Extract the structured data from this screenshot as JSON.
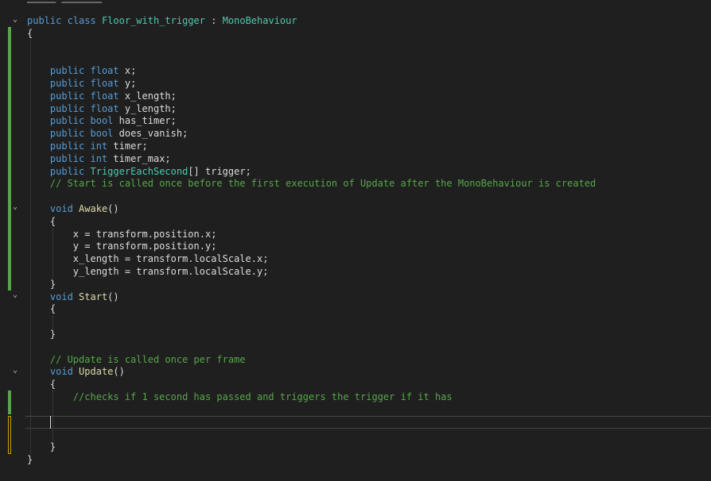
{
  "editor": {
    "language": "C#",
    "lines": [
      {
        "tokens": [
          {
            "t": "public",
            "c": "kw"
          },
          {
            "t": " "
          },
          {
            "t": "class",
            "c": "kw"
          },
          {
            "t": " "
          },
          {
            "t": "Floor_with_trigger",
            "c": "cls"
          },
          {
            "t": " : "
          },
          {
            "t": "MonoBehaviour",
            "c": "cls"
          }
        ]
      },
      {
        "tokens": [
          {
            "t": "{"
          }
        ]
      },
      {
        "tokens": []
      },
      {
        "tokens": []
      },
      {
        "tokens": [
          {
            "t": "    "
          },
          {
            "t": "public",
            "c": "kw"
          },
          {
            "t": " "
          },
          {
            "t": "float",
            "c": "kw"
          },
          {
            "t": " x;"
          }
        ]
      },
      {
        "tokens": [
          {
            "t": "    "
          },
          {
            "t": "public",
            "c": "kw"
          },
          {
            "t": " "
          },
          {
            "t": "float",
            "c": "kw"
          },
          {
            "t": " y;"
          }
        ]
      },
      {
        "tokens": [
          {
            "t": "    "
          },
          {
            "t": "public",
            "c": "kw"
          },
          {
            "t": " "
          },
          {
            "t": "float",
            "c": "kw"
          },
          {
            "t": " x_length;"
          }
        ]
      },
      {
        "tokens": [
          {
            "t": "    "
          },
          {
            "t": "public",
            "c": "kw"
          },
          {
            "t": " "
          },
          {
            "t": "float",
            "c": "kw"
          },
          {
            "t": " y_length;"
          }
        ]
      },
      {
        "tokens": [
          {
            "t": "    "
          },
          {
            "t": "public",
            "c": "kw"
          },
          {
            "t": " "
          },
          {
            "t": "bool",
            "c": "kw"
          },
          {
            "t": " has_timer;"
          }
        ]
      },
      {
        "tokens": [
          {
            "t": "    "
          },
          {
            "t": "public",
            "c": "kw"
          },
          {
            "t": " "
          },
          {
            "t": "bool",
            "c": "kw"
          },
          {
            "t": " does_vanish;"
          }
        ]
      },
      {
        "tokens": [
          {
            "t": "    "
          },
          {
            "t": "public",
            "c": "kw"
          },
          {
            "t": " "
          },
          {
            "t": "int",
            "c": "kw"
          },
          {
            "t": " timer;"
          }
        ]
      },
      {
        "tokens": [
          {
            "t": "    "
          },
          {
            "t": "public",
            "c": "kw"
          },
          {
            "t": " "
          },
          {
            "t": "int",
            "c": "kw"
          },
          {
            "t": " timer_max;"
          }
        ]
      },
      {
        "tokens": [
          {
            "t": "    "
          },
          {
            "t": "public",
            "c": "kw"
          },
          {
            "t": " "
          },
          {
            "t": "TriggerEachSecond",
            "c": "cls"
          },
          {
            "t": "[] trigger;"
          }
        ]
      },
      {
        "tokens": [
          {
            "t": "    "
          },
          {
            "t": "// Start is called once before the first execution of Update after the MonoBehaviour is created",
            "c": "cm"
          }
        ]
      },
      {
        "tokens": []
      },
      {
        "tokens": [
          {
            "t": "    "
          },
          {
            "t": "void",
            "c": "kw"
          },
          {
            "t": " "
          },
          {
            "t": "Awake",
            "c": "fn"
          },
          {
            "t": "()"
          }
        ]
      },
      {
        "tokens": [
          {
            "t": "    {"
          }
        ]
      },
      {
        "tokens": [
          {
            "t": "        x = transform.position.x;"
          }
        ]
      },
      {
        "tokens": [
          {
            "t": "        y = transform.position.y;"
          }
        ]
      },
      {
        "tokens": [
          {
            "t": "        x_length = transform.localScale.x;"
          }
        ]
      },
      {
        "tokens": [
          {
            "t": "        y_length = transform.localScale.y;"
          }
        ]
      },
      {
        "tokens": [
          {
            "t": "    }"
          }
        ]
      },
      {
        "tokens": [
          {
            "t": "    "
          },
          {
            "t": "void",
            "c": "kw"
          },
          {
            "t": " "
          },
          {
            "t": "Start",
            "c": "fn"
          },
          {
            "t": "()"
          }
        ]
      },
      {
        "tokens": [
          {
            "t": "    {"
          }
        ]
      },
      {
        "tokens": []
      },
      {
        "tokens": [
          {
            "t": "    }"
          }
        ]
      },
      {
        "tokens": []
      },
      {
        "tokens": [
          {
            "t": "    "
          },
          {
            "t": "// Update is called once per frame",
            "c": "cm"
          }
        ]
      },
      {
        "tokens": [
          {
            "t": "    "
          },
          {
            "t": "void",
            "c": "kw"
          },
          {
            "t": " "
          },
          {
            "t": "Update",
            "c": "fn"
          },
          {
            "t": "()"
          }
        ]
      },
      {
        "tokens": [
          {
            "t": "    {"
          }
        ]
      },
      {
        "tokens": [
          {
            "t": "        "
          },
          {
            "t": "//checks if 1 second has passed and triggers the trigger if it has",
            "c": "cm"
          }
        ]
      },
      {
        "tokens": []
      },
      {
        "tokens": []
      },
      {
        "tokens": []
      },
      {
        "tokens": [
          {
            "t": "    }"
          }
        ]
      },
      {
        "tokens": [
          {
            "t": "}"
          }
        ]
      }
    ],
    "fold_markers": [
      "chevron-down",
      "chevron-down",
      "chevron-down",
      "chevron-down"
    ],
    "colors": {
      "background": "#1f1f1f",
      "keyword": "#569cd6",
      "type": "#4ec9b0",
      "method": "#dcdcaa",
      "comment": "#57a64a",
      "text": "#dcdcdc",
      "change_saved": "#57a64a",
      "change_unsaved": "#c8a000"
    }
  }
}
